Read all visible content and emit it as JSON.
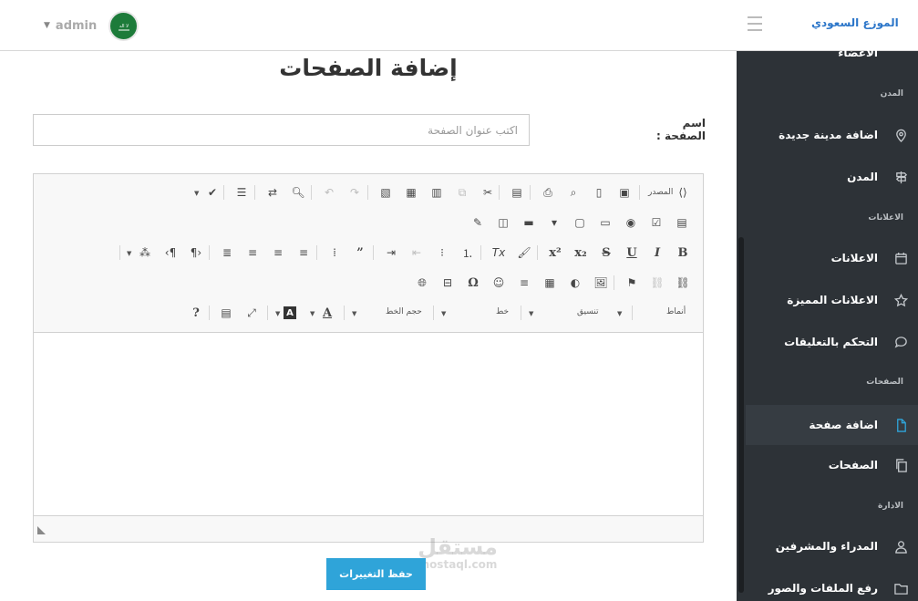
{
  "topbar": {
    "brand": "الموزع السعودي",
    "user_name": "admin"
  },
  "page": {
    "title": "إضافة الصفحات",
    "title_label": "اسم الصفحة :",
    "title_placeholder": "اكتب عنوان الصفحة",
    "save_label": "حفظ التغييرات"
  },
  "editor": {
    "source_label": "المصدر",
    "styles_label": "أنماط",
    "format_label": "تنسيق",
    "font_label": "خط",
    "size_label": "حجم الخط"
  },
  "watermark": {
    "line1": "مستقل",
    "line2": "mostaql.com"
  },
  "sidebar": {
    "partial_item": "الاعضاء",
    "sections": [
      {
        "heading": "المدن",
        "items": [
          "اضافة مدينة جديدة",
          "المدن"
        ]
      },
      {
        "heading": "الاعلانات",
        "items": [
          "الاعلانات",
          "الاعلانات المميزة",
          "التحكم بالتعليقات"
        ]
      },
      {
        "heading": "الصفحات",
        "items": [
          "اضافة صفحة",
          "الصفحات"
        ]
      },
      {
        "heading": "الادارة",
        "items": [
          "المدراء والمشرفين",
          "رفع الملفات والصور"
        ]
      }
    ]
  },
  "colors": {
    "accent": "#2fa4d9",
    "sidebar_bg": "#2d3237",
    "brand": "#2c76c9"
  }
}
